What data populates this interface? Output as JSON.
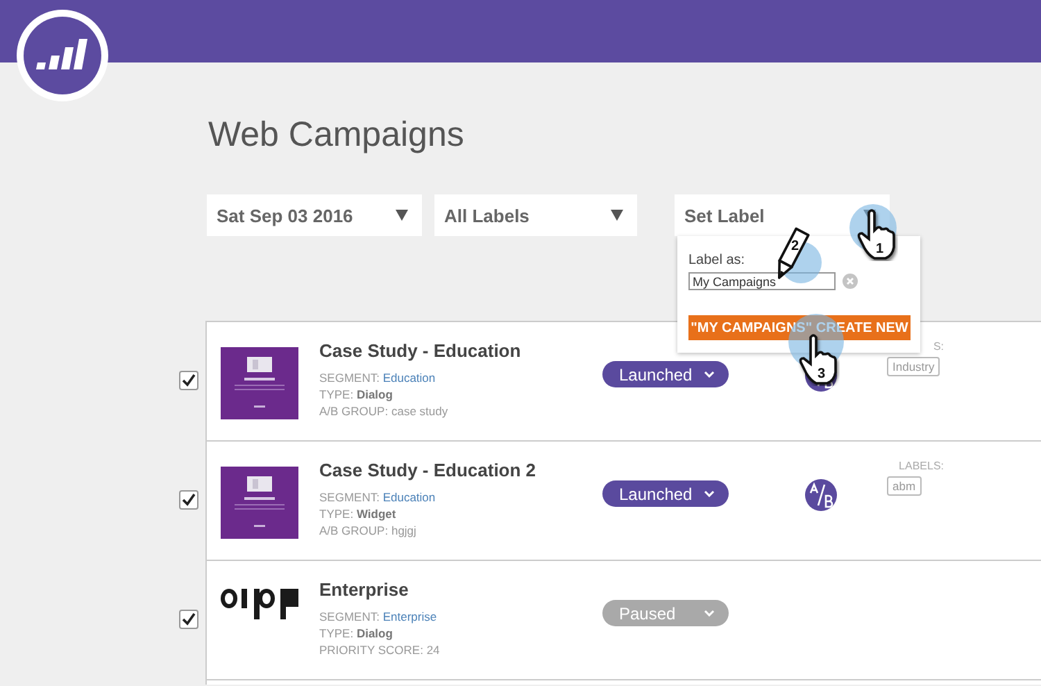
{
  "page_title": "Web Campaigns",
  "filters": [
    {
      "kind": "dropdown",
      "value": "Sat Sep 03 2016"
    },
    {
      "kind": "dropdown",
      "value": "All Labels"
    },
    {
      "kind": "label-menu",
      "value": "Set Label",
      "expanded": true
    }
  ],
  "label_popup": {
    "caption": "Label as:",
    "input_value": "My Campaigns",
    "create_button": "\"MY CAMPAIGNS\" CREATE NEW"
  },
  "annotations": [
    {
      "kind": "hand",
      "number": "1"
    },
    {
      "kind": "pencil",
      "number": "2"
    },
    {
      "kind": "hand",
      "number": "3"
    }
  ],
  "campaigns": [
    {
      "checked": true,
      "title": "Case Study - Education",
      "segment_label": "SEGMENT:",
      "segment": "Education",
      "type_label": "TYPE:",
      "type": "Dialog",
      "extra_label": "A/B GROUP:",
      "extra": "case study",
      "status": {
        "kind": "launched",
        "label": "Launched"
      },
      "ab_test": true,
      "labels_heading": "S:",
      "labels": [
        "Industry"
      ]
    },
    {
      "checked": true,
      "title": "Case Study - Education 2",
      "segment_label": "SEGMENT:",
      "segment": "Education",
      "type_label": "TYPE:",
      "type": "Widget",
      "extra_label": "A/B GROUP:",
      "extra": "hgjgj",
      "status": {
        "kind": "launched",
        "label": "Launched"
      },
      "ab_test": true,
      "labels_heading": "LABELS:",
      "labels": [
        "abm"
      ]
    },
    {
      "checked": true,
      "title": "Enterprise",
      "segment_label": "SEGMENT:",
      "segment": "Enterprise",
      "type_label": "TYPE:",
      "type": "Dialog",
      "extra_label": "PRIORITY SCORE:",
      "extra": "24",
      "status": {
        "kind": "paused",
        "label": "Paused"
      },
      "ab_test": false
    }
  ]
}
